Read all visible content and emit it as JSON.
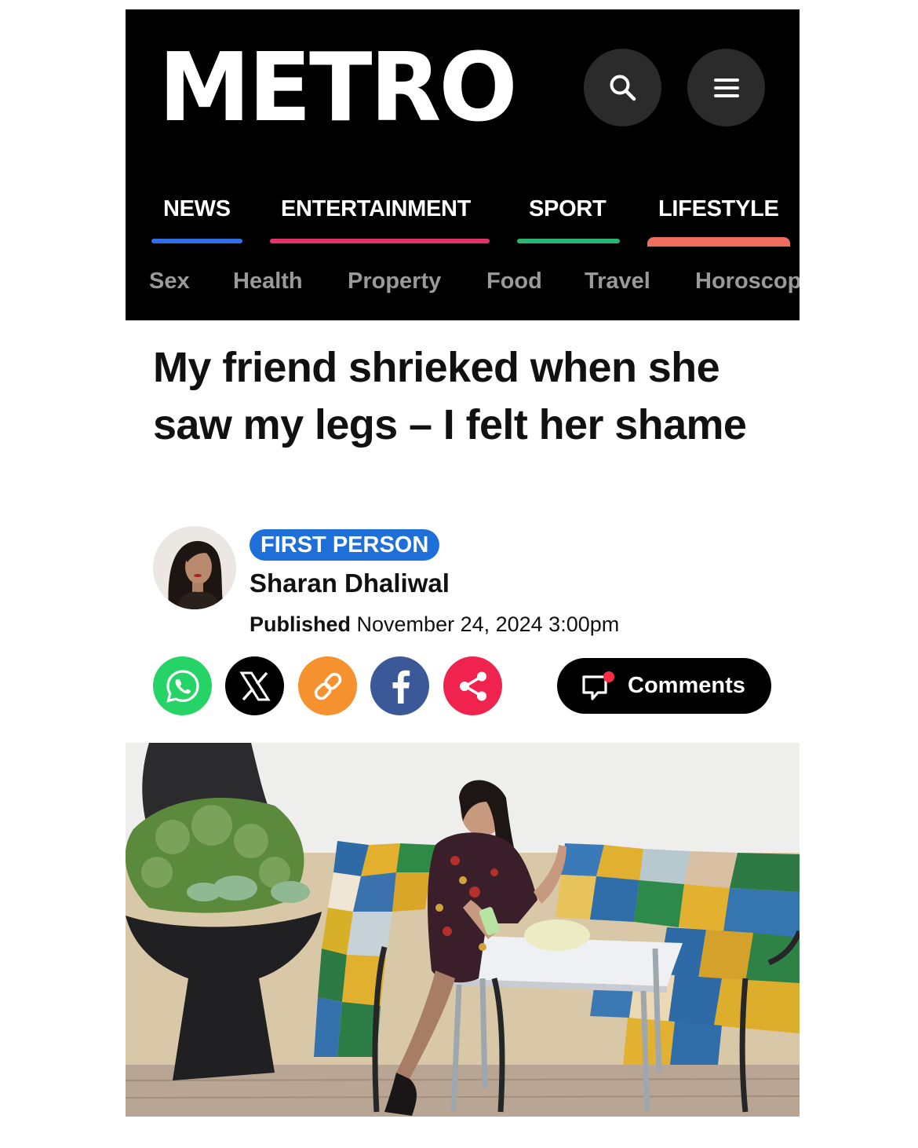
{
  "brand": {
    "logo_text": "METRO",
    "accent_colors": {
      "news": "#2f6fe4",
      "entertainment": "#e3336b",
      "sport": "#2bb673",
      "lifestyle": "#f06e5e"
    }
  },
  "header": {
    "search_icon": "search-icon",
    "menu_icon": "hamburger-menu-icon"
  },
  "main_nav": [
    {
      "label": "NEWS"
    },
    {
      "label": "ENTERTAINMENT"
    },
    {
      "label": "SPORT"
    },
    {
      "label": "LIFESTYLE"
    }
  ],
  "sub_nav": [
    {
      "label": "Sex"
    },
    {
      "label": "Health"
    },
    {
      "label": "Property"
    },
    {
      "label": "Food"
    },
    {
      "label": "Travel"
    },
    {
      "label": "Horoscop"
    }
  ],
  "article": {
    "headline": "My friend shrieked when she saw my legs – I felt her shame",
    "tag": "FIRST PERSON",
    "author": "Sharan Dhaliwal",
    "published_label": "Published",
    "published_date": "November 24, 2024 3:00pm"
  },
  "share": {
    "buttons": [
      {
        "icon": "whatsapp-icon",
        "color": "#25d366"
      },
      {
        "icon": "x-icon",
        "color": "#000000"
      },
      {
        "icon": "link-icon",
        "color": "#f5922f"
      },
      {
        "icon": "facebook-icon",
        "color": "#3b5998"
      },
      {
        "icon": "share-icon",
        "color": "#f0234e"
      }
    ],
    "comments_label": "Comments"
  }
}
